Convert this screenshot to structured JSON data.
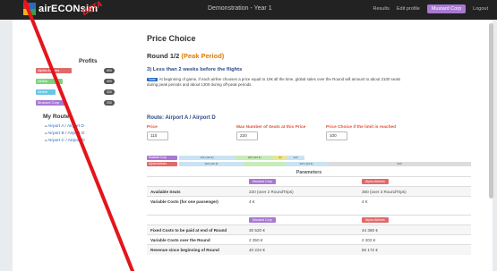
{
  "navbar": {
    "brand": "airECONsim",
    "beta": "BETA",
    "center_title": "Demonstration - Year 1",
    "links": [
      "Results",
      "Edit profile"
    ],
    "airline_badge": "Mustard Corp",
    "logout": "Logout"
  },
  "sidebar": {
    "profits_title": "Profits",
    "profits": [
      {
        "name": "Alpha Airlines",
        "value": "600",
        "color": "#e06a6a"
      },
      {
        "name": "Airline",
        "value": "400",
        "color": "#7ed37e"
      },
      {
        "name": "Airline",
        "value": "300",
        "color": "#6ac5e8"
      },
      {
        "name": "Mustard Corp",
        "value": "200",
        "color": "#a878d2"
      }
    ],
    "routes_title": "My Routes",
    "routes": [
      "Airport A / Airport D",
      "Airport B / Airport D",
      "Airport C / Airport D"
    ]
  },
  "main": {
    "title": "Price Choice",
    "round": "Round 1/2",
    "period": "(Peak Period)",
    "deadline": "3) Less than 2 weeks before the flights",
    "info_badge": "Note",
    "info_text": "At beginning of game, if each airline chooses a price equal to 10€ all the time, global sales over the Round will amount to about 2100 seats during peak periods and about 1300 during off-peak periods.",
    "route_title": "Route: Airport A / Airport D",
    "fields": [
      {
        "label": "Price",
        "value": "110"
      },
      {
        "label": "Max Number of Seats at this Price",
        "value": "220"
      },
      {
        "label": "Price Choice if the limit is reached",
        "value": "100"
      }
    ],
    "chart": {
      "rows": [
        {
          "airline": "Mustard Corp",
          "color": "#a878d2",
          "segments": [
            "100 (110 €)",
            "180 (110 €)",
            "37",
            "220"
          ]
        },
        {
          "airline": "Alpha Airlines",
          "color": "#e06a6a",
          "segments": [
            "400 (110 €)",
            "",
            "300 (110 €)",
            "300"
          ]
        }
      ]
    },
    "params_caption": "Parameters",
    "table1": {
      "heads": [
        "Mustard Corp",
        "Alpha Airlines"
      ],
      "rows": [
        {
          "label": "Available Seats",
          "a": "220 (over 2 RoundTrips)",
          "b": "360 (over 3 RoundTrips)"
        },
        {
          "label": "Variable Costs (for one passenger)",
          "a": "4 €",
          "b": "4 €"
        }
      ]
    },
    "table2": {
      "heads": [
        "Mustard Corp",
        "Alpha Airlines"
      ],
      "rows": [
        {
          "label": "Fixed Costs to be paid at end of Round",
          "a": "30 520 €",
          "b": "44 360 €"
        },
        {
          "label": "Variable Costs over the Round",
          "a": "2 350 €",
          "b": "2 202 €"
        },
        {
          "label": "Revenue since beginning of Round",
          "a": "40 224 €",
          "b": "50 172 €"
        }
      ]
    }
  }
}
